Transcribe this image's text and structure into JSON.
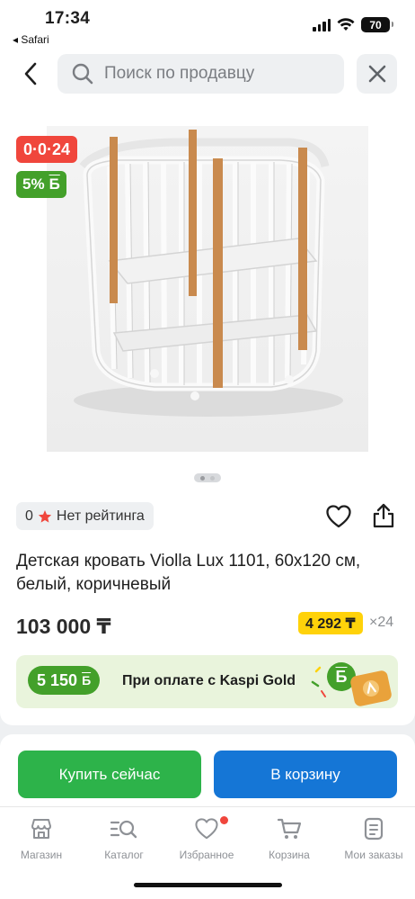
{
  "status_bar": {
    "time": "17:34",
    "back_app": "◂ Safari",
    "battery": "70"
  },
  "search": {
    "placeholder": "Поиск по продавцу"
  },
  "product": {
    "installment_badge": "0·0·24",
    "bonus_badge": "5%",
    "bonus_symbol": "Б",
    "rating_value": "0",
    "rating_text": "Нет рейтинга",
    "title": "Детская кровать Violla Lux 1101, 60x120 см, белый, коричневый",
    "price": "103 000 ₸",
    "monthly_payment": "4 292 ₸",
    "months": "×24",
    "image_count": 2,
    "current_image": 1
  },
  "kaspi_gold": {
    "bonus": "5 150",
    "bonus_symbol": "Б",
    "text": "При оплате с Kaspi Gold"
  },
  "actions": {
    "buy_now": "Купить сейчас",
    "add_to_cart": "В корзину"
  },
  "tabbar": {
    "items": [
      {
        "label": "Магазин",
        "icon": "store-icon"
      },
      {
        "label": "Каталог",
        "icon": "catalog-search-icon"
      },
      {
        "label": "Избранное",
        "icon": "heart-icon",
        "has_dot": true
      },
      {
        "label": "Корзина",
        "icon": "cart-icon"
      },
      {
        "label": "Мои заказы",
        "icon": "orders-icon"
      }
    ]
  },
  "colors": {
    "installment_red": "#f0463c",
    "bonus_green": "#43a02a",
    "buy_green": "#2db34a",
    "cart_blue": "#1576d6",
    "monthly_yellow": "#ffd20a",
    "banner_bg": "#e9f4dc"
  }
}
